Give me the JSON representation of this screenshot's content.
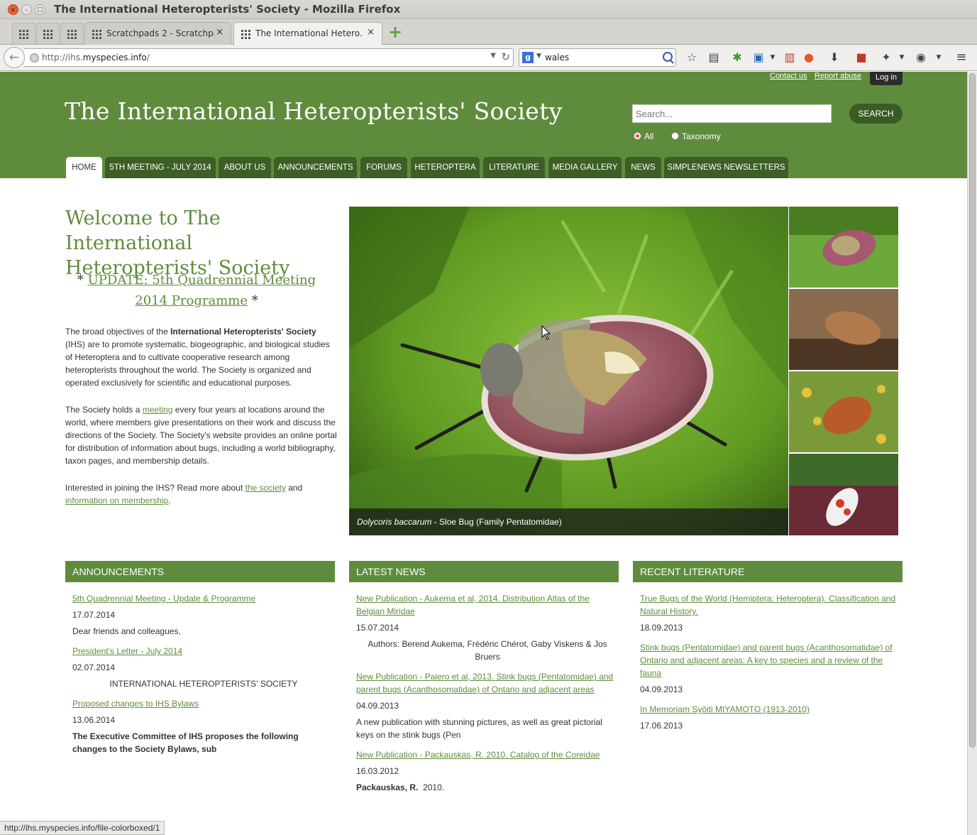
{
  "window": {
    "title": "The International Heteropterists' Society - Mozilla Firefox",
    "close_glyph": "×",
    "min_glyph": "–",
    "max_glyph": "□"
  },
  "tabs": [
    {
      "label": "Scratchpads 2 - Scratchpa...",
      "close": "×",
      "active": false
    },
    {
      "label": "The International Hetero...",
      "close": "×",
      "active": true
    }
  ],
  "new_tab_glyph": "+",
  "navbar": {
    "back_glyph": "←",
    "url_prefix": "http://ihs.",
    "url_domain": "myspecies.info",
    "url_suffix": "/",
    "search_engine_glyph": "g",
    "search_query": "wales"
  },
  "header": {
    "contact_link": "Contact us",
    "report_link": "Report abuse",
    "login_button": "Log in",
    "site_title": "The International Heteropterists' Society",
    "search_placeholder": "Search...",
    "search_button": "SEARCH",
    "radio_all": "All",
    "radio_taxonomy": "Taxonomy"
  },
  "nav": [
    {
      "label": "HOME",
      "active": true
    },
    {
      "label": "5TH MEETING - JULY 2014"
    },
    {
      "label": "ABOUT US"
    },
    {
      "label": "ANNOUNCEMENTS"
    },
    {
      "label": "FORUMS"
    },
    {
      "label": "HETEROPTERA"
    },
    {
      "label": "LITERATURE"
    },
    {
      "label": "MEDIA GALLERY"
    },
    {
      "label": "NEWS"
    },
    {
      "label": "SIMPLENEWS NEWSLETTERS"
    }
  ],
  "welcome": {
    "title": "Welcome to The International Heteropterists' Society",
    "update_star_left": "* ",
    "update_link": "UPDATE: 5th Quadrennial Meeting 2014 Programme",
    "update_star_right": " *",
    "p1_start": "The broad objectives of the ",
    "p1_bold": "International Heteropterists' Society",
    "p1_end": " (IHS) are to promote systematic, biogeographic, and biological studies of Heteroptera and to cultivate cooperative research among heteropterists throughout the world. The Society is organized and operated exclusively for scientific and educational purposes.",
    "p2_start": "The Society holds a ",
    "p2_link": "meeting",
    "p2_end": " every four years at locations around the world, where members give presentations on their work and discuss the directions of the Society. The Society's website provides an online portal for distribution of information about bugs, including a world bibliography, taxon pages, and membership details.",
    "p3_start": "Interested in joining the IHS? Read more about ",
    "p3_link1": "the society",
    "p3_mid": " and ",
    "p3_link2": "information on membership",
    "p3_end": "."
  },
  "gallery": {
    "caption_species": "Dolycoris baccarum",
    "caption_rest": " - Sloe Bug (Family Pentatomidae)"
  },
  "announcements": {
    "header": "ANNOUNCEMENTS",
    "items": [
      {
        "title": "5th Quadrennial Meeting - Update & Programme",
        "date": "17.07.2014",
        "teaser": "Dear friends and colleagues,"
      },
      {
        "title": "President's Letter - July 2014",
        "date": "02.07.2014",
        "teaser": "INTERNATIONAL HETEROPTERISTS' SOCIETY"
      },
      {
        "title": "Proposed changes to IHS Bylaws",
        "date": "13.06.2014",
        "teaser": "The Executive Committee of IHS proposes the following changes to the Society Bylaws, sub"
      }
    ]
  },
  "news": {
    "header": "LATEST NEWS",
    "items": [
      {
        "title": "New Publication - Aukema et al, 2014. Distribution Atlas of the Belgian Miridae",
        "date": "15.07.2014",
        "teaser": "Authors: Berend Aukema, Frédéric Chérot, Gaby Viskens & Jos Bruers"
      },
      {
        "title": "New Publication - Paiero et al, 2013. Stink bugs (Pentatomidae) and parent bugs (Acanthosomatidae) of Ontario and adjacent areas",
        "date": "04.09.2013",
        "teaser": "A new publication with stunning pictures, as well as great pictorial keys on the stink bugs (Pen"
      },
      {
        "title": "New Publication - Packauskas, R. 2010. Catalog of the Coreidae",
        "date": "16.03.2012",
        "teaser_bold": "Packauskas, R.",
        "teaser": "  2010."
      }
    ]
  },
  "literature": {
    "header": "RECENT LITERATURE",
    "items": [
      {
        "title": "True Bugs of the World (Hemiptera: Heteroptera). Classification and Natural History.",
        "date": "18.09.2013"
      },
      {
        "title": "Stink bugs (Pentatomidae) and parent bugs (Acanthosomatidae) of Ontario and adjacent areas: A key to species and a review of the fauna",
        "date": "04.09.2013"
      },
      {
        "title": "In Memoriam Syôiti MIYAMOTO (1913-2010)",
        "date": "17.06.2013"
      }
    ]
  },
  "status_bar": "http://ihs.myspecies.info/file-colorboxed/1",
  "colors": {
    "brand_green": "#5f8c3c",
    "nav_dark": "#3d5f25",
    "search_button": "#3b5a25"
  }
}
